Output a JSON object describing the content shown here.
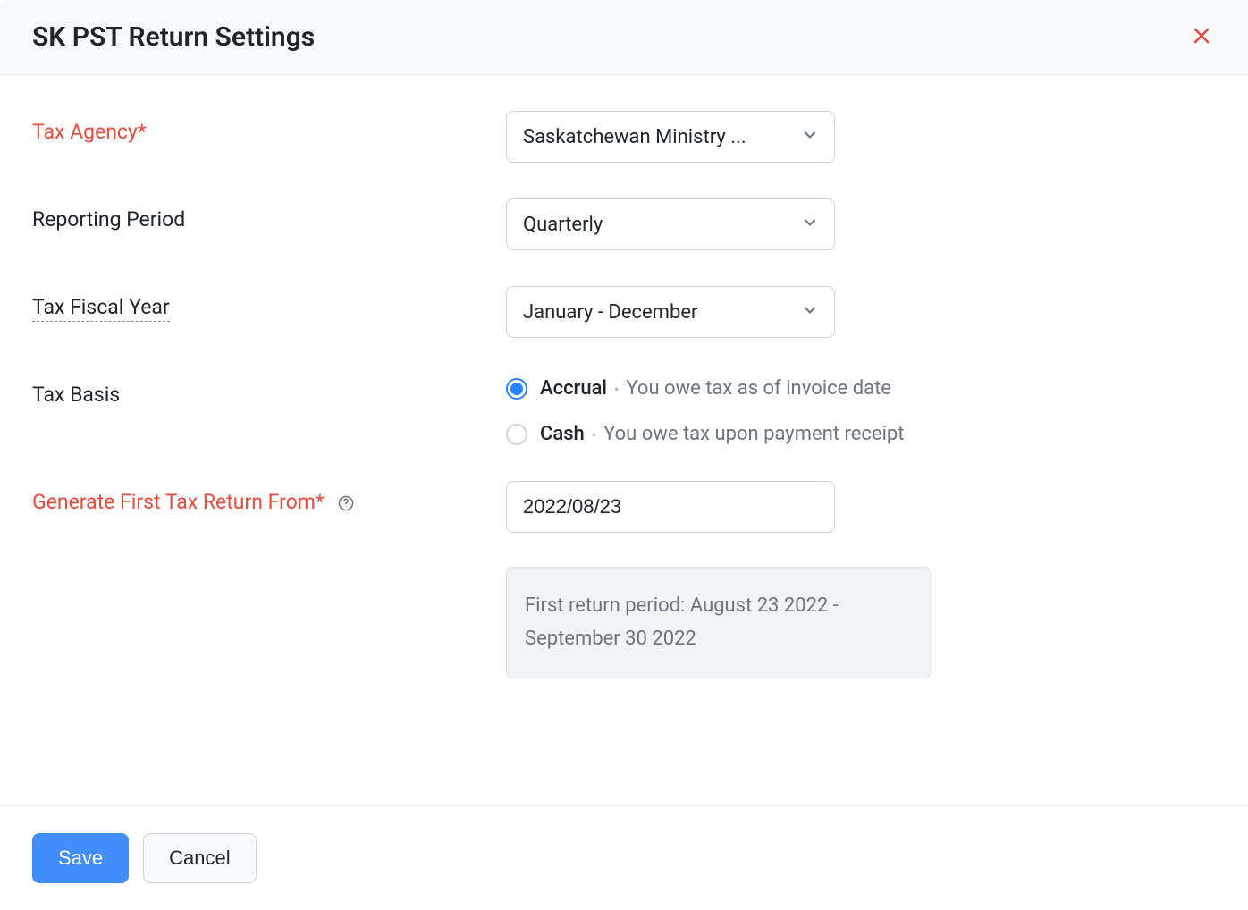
{
  "header": {
    "title": "SK PST Return Settings"
  },
  "form": {
    "tax_agency": {
      "label": "Tax Agency*",
      "value": "Saskatchewan Ministry ..."
    },
    "reporting_period": {
      "label": "Reporting Period",
      "value": "Quarterly"
    },
    "tax_fiscal_year": {
      "label": "Tax Fiscal Year",
      "value": "January - December"
    },
    "tax_basis": {
      "label": "Tax Basis",
      "options": [
        {
          "label": "Accrual",
          "hint": "You owe tax as of invoice date",
          "checked": true
        },
        {
          "label": "Cash",
          "hint": "You owe tax upon payment receipt",
          "checked": false
        }
      ]
    },
    "first_return_from": {
      "label": "Generate First Tax Return From*",
      "value": "2022/08/23"
    },
    "info_box": "First return period: August 23 2022 - September 30 2022"
  },
  "footer": {
    "save": "Save",
    "cancel": "Cancel"
  }
}
